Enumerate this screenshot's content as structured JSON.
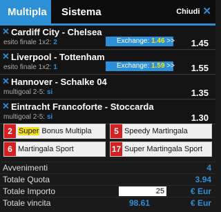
{
  "tabs": {
    "active": "Multipla",
    "other": "Sistema",
    "close_label": "Chiudi"
  },
  "bets": [
    {
      "match": "Cardiff City - Chelsea",
      "market": "esito finale 1x2:",
      "selection": "2",
      "odd": "1.45",
      "exchange_label": "Exchange:",
      "exchange_value": "1.46",
      "exchange_arrow": ">>"
    },
    {
      "match": "Liverpool - Tottenham",
      "market": "esito finale 1x2:",
      "selection": "1",
      "odd": "1.55",
      "exchange_label": "Exchange:",
      "exchange_value": "1.59",
      "exchange_arrow": ">>"
    },
    {
      "match": "Hannover - Schalke 04",
      "market": "multigoal 2-5:",
      "selection": "si",
      "odd": "1.35"
    },
    {
      "match": "Eintracht Francoforte - Stoccarda",
      "market": "multigoal 2-5:",
      "selection": "si",
      "odd": "1.30"
    }
  ],
  "promos": [
    {
      "badge": "2",
      "highlight": "Super",
      "label": " Bonus Multipla"
    },
    {
      "badge": "5",
      "label": "Speedy Martingala"
    },
    {
      "badge": "6",
      "label": "Martingala Sport"
    },
    {
      "badge": "17",
      "label": "Super Martingala Sport"
    }
  ],
  "summary": {
    "avvenimenti_label": "Avvenimenti",
    "avvenimenti_value": "4",
    "quota_label": "Totale Quota",
    "quota_value": "3.94",
    "importo_label": "Totale Importo",
    "importo_value": "25",
    "importo_currency": "€ Eur",
    "vincita_label": "Totale vincita",
    "vincita_value": "98.61",
    "vincita_currency": "€ Eur"
  }
}
